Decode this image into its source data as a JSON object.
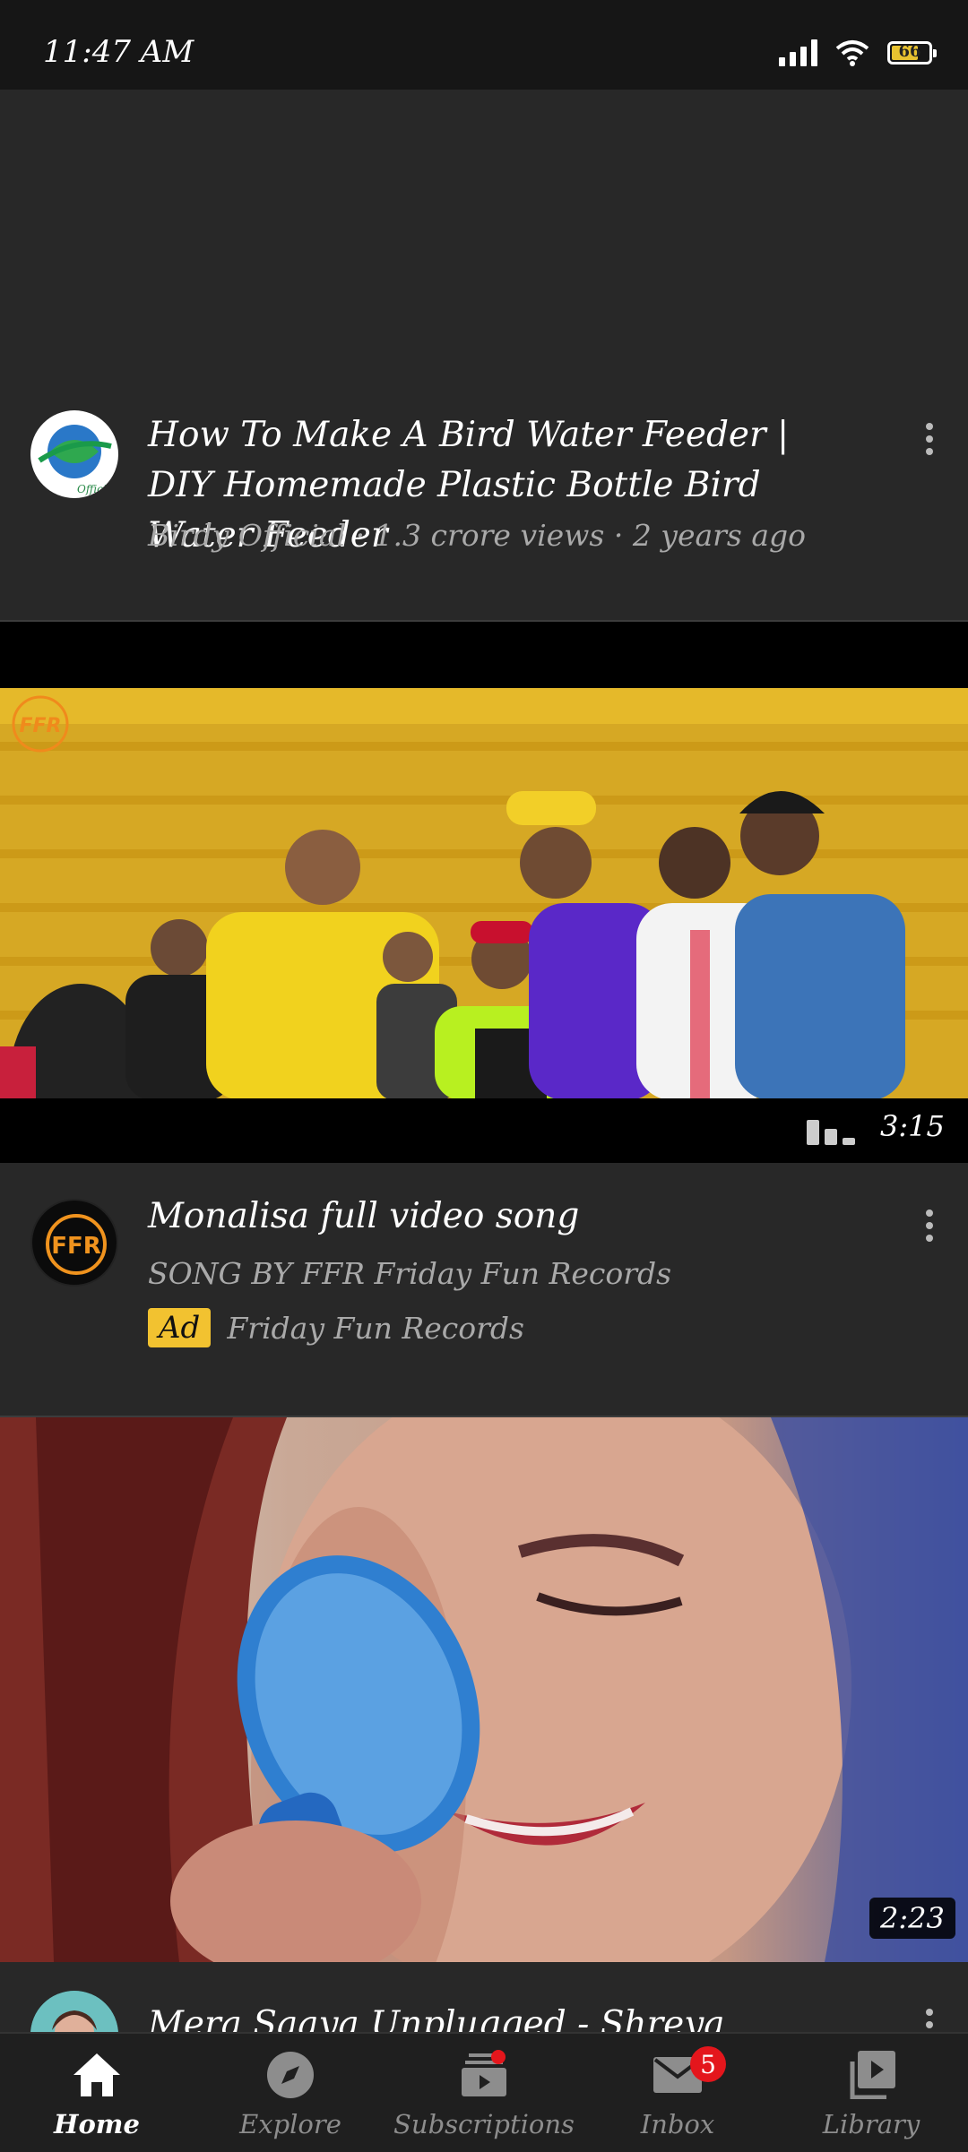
{
  "status_bar": {
    "time": "11:47 AM",
    "battery": "66",
    "icons": [
      "signal-icon",
      "wifi-icon",
      "battery-icon"
    ]
  },
  "videos": [
    {
      "title": "How To Make A Bird Water Feeder | DIY Homemade Plastic Bottle Bird Water Feeder",
      "meta": "Birdy Official · 1.3 crore views · 2 years ago",
      "avatar_text": "Official"
    },
    {
      "title": "Monalisa full video song",
      "channel_line": "SONG BY FFR Friday Fun Records",
      "ad_label": "Ad",
      "advertiser": "Friday Fun Records",
      "duration": "3:15",
      "logo_text": "FFR",
      "avatar_text": "FFR"
    },
    {
      "title": "Mera Saaya Unplugged - Shreya Ghoshal Live",
      "duration": "2:23"
    }
  ],
  "bottom_nav": {
    "items": [
      {
        "label": "Home",
        "icon": "home-icon",
        "active": true
      },
      {
        "label": "Explore",
        "icon": "compass-icon"
      },
      {
        "label": "Subscriptions",
        "icon": "subscriptions-icon"
      },
      {
        "label": "Inbox",
        "icon": "mail-icon",
        "badge": "5"
      },
      {
        "label": "Library",
        "icon": "library-icon"
      }
    ]
  },
  "colors": {
    "background": "#282828",
    "status_bar": "#161616",
    "ad_badge": "#f2c230",
    "badge_red": "#e4161c"
  }
}
